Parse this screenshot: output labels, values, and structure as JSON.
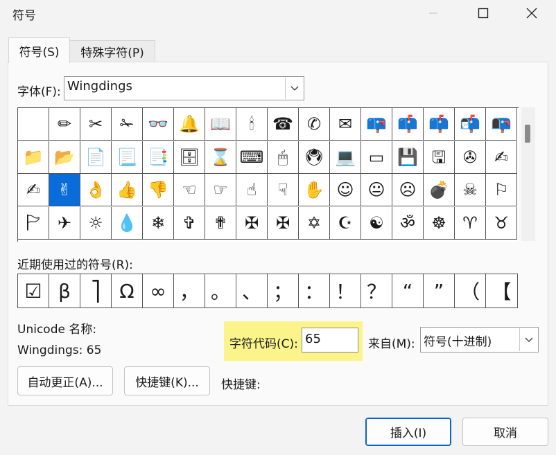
{
  "window": {
    "title": "符号"
  },
  "tabs": [
    {
      "label": "符号(S)"
    },
    {
      "label": "特殊字符(P)"
    }
  ],
  "font": {
    "label": "字体(F):",
    "value": "Wingdings"
  },
  "symbols": {
    "rows": [
      [
        " ",
        "✏",
        "✂",
        "✁",
        "👓",
        "🔔",
        "📖",
        "🕯",
        "☎",
        "✆",
        "✉",
        "📪",
        "📫",
        "📫",
        "📬",
        "📭"
      ],
      [
        "📁",
        "📂",
        "📄",
        "📃",
        "📑",
        "🗄",
        "⌛",
        "⌨",
        "🖱",
        "🖲",
        "💻",
        "▭",
        "💾",
        "🖫",
        "✇",
        "✍"
      ],
      [
        "✍",
        "✌",
        "👌",
        "👍",
        "👎",
        "☜",
        "☞",
        "☝",
        "☟",
        "✋",
        "☺",
        "😐",
        "☹",
        "💣",
        "☠",
        "⚐"
      ],
      [
        "🏱",
        "✈",
        "☼",
        "💧",
        "❄",
        "✞",
        "✟",
        "✠",
        "✠",
        "✡",
        "☪",
        "☯",
        "ॐ",
        "☸",
        "♈",
        "♉"
      ]
    ],
    "selected": {
      "row": 2,
      "col": 1
    }
  },
  "recent": {
    "label": "近期使用过的符号(R):",
    "items": [
      "☑",
      "β",
      "⎤",
      "Ω",
      "∞",
      "，",
      "。",
      "、",
      "；",
      "：",
      "！",
      "？",
      "“",
      "”",
      "（",
      "【"
    ]
  },
  "unicode_name": {
    "label": "Unicode 名称:",
    "value": "Wingdings: 65"
  },
  "char_code": {
    "label": "字符代码(C):",
    "value": "65"
  },
  "from": {
    "label": "来自(M):",
    "value": "符号(十进制)"
  },
  "buttons": {
    "autocorrect": "自动更正(A)...",
    "shortcut_key": "快捷键(K)...",
    "shortcut_label": "快捷键:",
    "insert": "插入(I)",
    "cancel": "取消"
  },
  "colors": {
    "highlight": "#fbf48a",
    "selection": "#0a6cd8"
  }
}
